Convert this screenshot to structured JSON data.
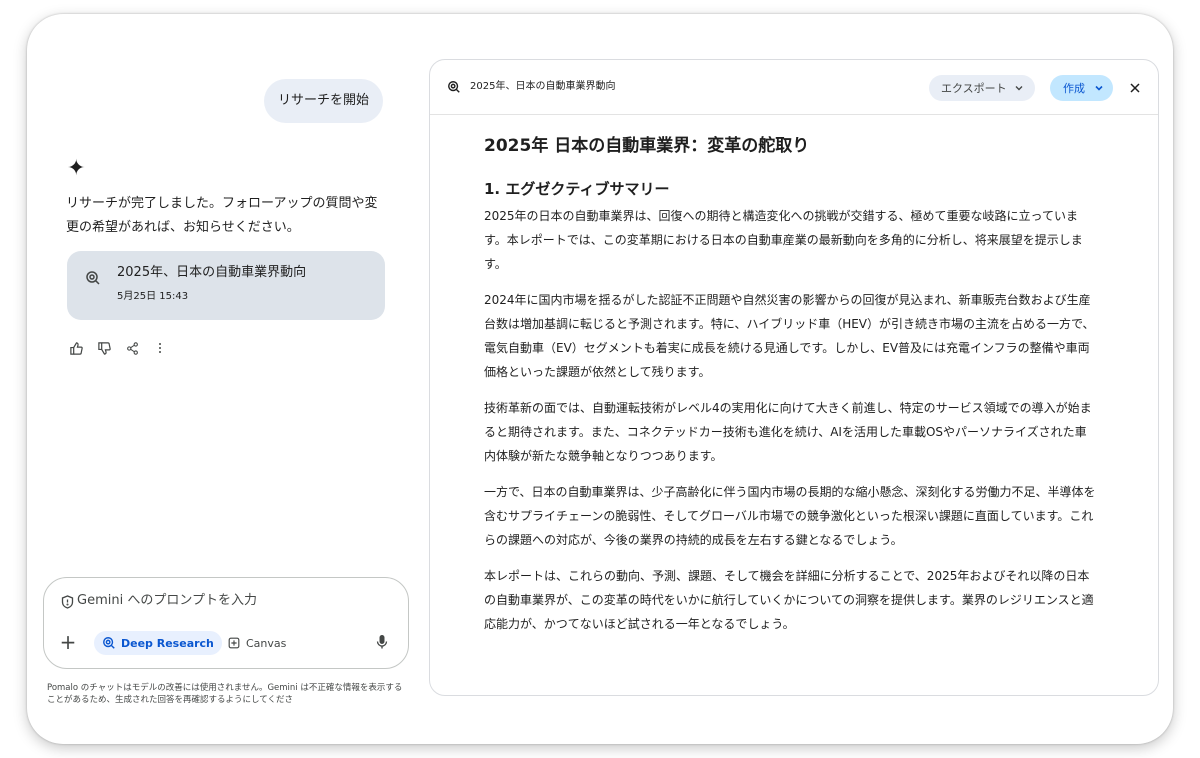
{
  "chat": {
    "user_message": "リサーチを開始",
    "assistant_message": "リサーチが完了しました。フォローアップの質問や変更の希望があれば、お知らせください。",
    "report_card": {
      "title": "2025年、日本の自動車業界動向",
      "date": "5月25日 15:43",
      "icon": "deep-research-icon"
    },
    "feedback_icons": [
      "thumb-up-icon",
      "thumb-down-icon",
      "share-icon",
      "more-vert-icon"
    ]
  },
  "prompt": {
    "placeholder": "Gemini へのプロンプトを入力",
    "deep_research_label": "Deep Research",
    "canvas_label": "Canvas",
    "accent_color": "#0b57d0"
  },
  "disclaimer": "Pomalo のチャットはモデルの改善には使用されません。Gemini は不正確な情報を表示することがあるため、生成された回答を再確認するようにしてくださ",
  "panel": {
    "title": "2025年、日本の自動車業界動向",
    "export_label": "エクスポート",
    "create_label": "作成",
    "create_color": "#c2e7ff"
  },
  "report": {
    "heading": "2025年 日本の自動車業界：変革の舵取り",
    "section_heading": "1. エグゼクティブサマリー",
    "paragraphs": [
      "2025年の日本の自動車業界は、回復への期待と構造変化への挑戦が交錯する、極めて重要な岐路に立っています。本レポートでは、この変革期における日本の自動車産業の最新動向を多角的に分析し、将来展望を提示します。",
      "2024年に国内市場を揺るがした認証不正問題や自然災害の影響からの回復が見込まれ、新車販売台数および生産台数は増加基調に転じると予測されます。特に、ハイブリッド車（HEV）が引き続き市場の主流を占める一方で、電気自動車（EV）セグメントも着実に成長を続ける見通しです。しかし、EV普及には充電インフラの整備や車両価格といった課題が依然として残ります。",
      "技術革新の面では、自動運転技術がレベル4の実用化に向けて大きく前進し、特定のサービス領域での導入が始まると期待されます。また、コネクテッドカー技術も進化を続け、AIを活用した車載OSやパーソナライズされた車内体験が新たな競争軸となりつつあります。",
      "一方で、日本の自動車業界は、少子高齢化に伴う国内市場の長期的な縮小懸念、深刻化する労働力不足、半導体を含むサプライチェーンの脆弱性、そしてグローバル市場での競争激化といった根深い課題に直面しています。これらの課題への対応が、今後の業界の持続的成長を左右する鍵となるでしょう。",
      "本レポートは、これらの動向、予測、課題、そして機会を詳細に分析することで、2025年およびそれ以降の日本の自動車業界が、この変革の時代をいかに航行していくかについての洞察を提供します。業界のレジリエンスと適応能力が、かつてないほど試される一年となるでしょう。"
    ]
  }
}
